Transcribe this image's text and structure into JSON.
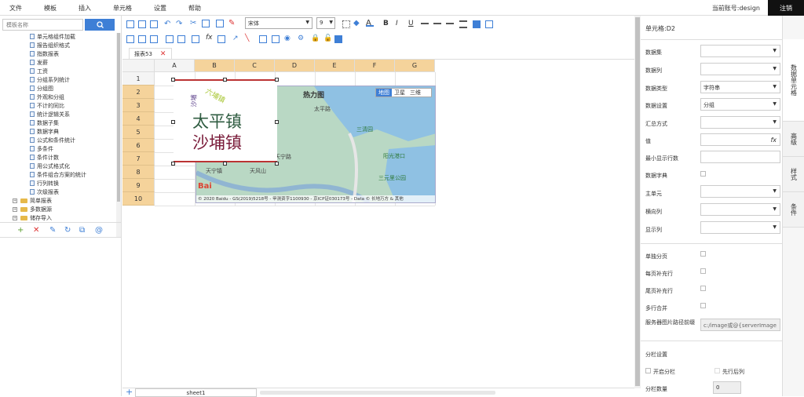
{
  "menubar": {
    "items": [
      "文件",
      "模板",
      "插入",
      "单元格",
      "设置",
      "帮助"
    ],
    "account": "当前账号:design",
    "logout": "注销"
  },
  "left_panel": {
    "search_placeholder": "模板名称",
    "tree": [
      "单元格组件加载",
      "报告组织格式",
      "指数报表",
      "发薪",
      "工资",
      "分组系列统计",
      "分组图",
      "外观和分组",
      "不计的同比",
      "统计逻辑关系",
      "数据子集",
      "数据字典",
      "公式和条件统计",
      "多条件",
      "条件计数",
      "用公式格式化",
      "条件组合方案的统计",
      "行列转换",
      "次级报表"
    ],
    "folders": [
      "简单报表",
      "多数据源",
      "储存导入"
    ]
  },
  "toolbar": {
    "font": "宋体",
    "size": "9"
  },
  "tabs": {
    "report_tab": "报表53"
  },
  "grid": {
    "columns": [
      "A",
      "B",
      "C",
      "D",
      "E",
      "F",
      "G"
    ],
    "rows": [
      "1",
      "2",
      "3",
      "4",
      "5",
      "6",
      "7",
      "8",
      "9",
      "10"
    ]
  },
  "map": {
    "controls": [
      "地图",
      "卫星",
      "三维"
    ],
    "labels": [
      "热力图",
      "太平镇",
      "沙埔镇",
      "天宁镇",
      "太平路",
      "天风山",
      "天宁路",
      "三清园",
      "阳光港口",
      "三元里公园"
    ],
    "brand": "Bai",
    "copyright": "© 2020 Baidu - GS(2019)5218号 - 甲测资字1100930 - 京ICP证030173号 - Data © 长地万方 & 其他"
  },
  "textbox": {
    "line1": "太平镇",
    "line2": "沙埔镇",
    "small1": "六埔镇",
    "small2": "沙埔"
  },
  "sheetbar": {
    "add": "+",
    "sheet": "sheet1"
  },
  "right_panel": {
    "title": "单元格:D2",
    "fields": [
      {
        "label": "数据集",
        "value": ""
      },
      {
        "label": "数据列",
        "value": ""
      },
      {
        "label": "数据类型",
        "value": "字符串"
      },
      {
        "label": "数据设置",
        "value": "分组"
      },
      {
        "label": "汇总方式",
        "value": ""
      },
      {
        "label": "值",
        "value": ""
      },
      {
        "label": "最小显示行数",
        "value": ""
      },
      {
        "label": "数据字典",
        "value": ""
      },
      {
        "label": "主单元",
        "value": ""
      },
      {
        "label": "横向列",
        "value": ""
      },
      {
        "label": "显示列",
        "value": ""
      }
    ],
    "checks": [
      "单独分页",
      "每页补充行",
      "尾页补充行",
      "多行合并"
    ],
    "server_label": "服务器图片路径前缀",
    "server_value": "c:/image或@{serverImage",
    "section": "分栏设置",
    "opt1": "开启分栏",
    "opt2": "先行后列",
    "colcount_label": "分栏数量",
    "colcount_value": "0"
  },
  "side_tabs": [
    "数据单元格",
    "高级",
    "样式",
    "条件"
  ]
}
